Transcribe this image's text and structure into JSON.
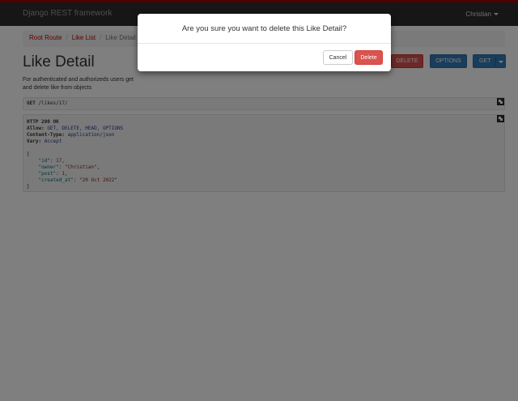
{
  "navbar": {
    "brand": "Django REST framework",
    "user": "Christian"
  },
  "breadcrumb": {
    "items": [
      "Root Route",
      "Like List"
    ],
    "active": "Like Detail"
  },
  "header": {
    "title": "Like Detail",
    "description": "For authenticated and authorizeds users get and delete like from objects"
  },
  "buttons": {
    "delete": "DELETE",
    "options": "OPTIONS",
    "get": "GET"
  },
  "request": {
    "method": "GET",
    "path": "/likes/17/"
  },
  "response": {
    "status_line": "HTTP 200 OK",
    "headers": [
      {
        "name": "Allow:",
        "value": "GET, DELETE, HEAD, OPTIONS"
      },
      {
        "name": "Content-Type:",
        "value": "application/json"
      },
      {
        "name": "Vary:",
        "value": "Accept"
      }
    ],
    "body": {
      "open": "{",
      "fields": [
        {
          "key": "\"id\"",
          "value": "17",
          "sep": ","
        },
        {
          "key": "\"owner\"",
          "value": "\"Christian\"",
          "sep": ","
        },
        {
          "key": "\"post\"",
          "value": "1",
          "sep": ","
        },
        {
          "key": "\"created_at\"",
          "value": "\"20 Oct 2022\"",
          "sep": ""
        }
      ],
      "close": "}"
    }
  },
  "modal": {
    "message": "Are you sure you want to delete this Like Detail?",
    "cancel": "Cancel",
    "confirm": "Delete"
  },
  "colors": {
    "navbar_accent": "#a30000",
    "danger": "#d9534f",
    "primary": "#337ab7",
    "link": "#c20000"
  }
}
